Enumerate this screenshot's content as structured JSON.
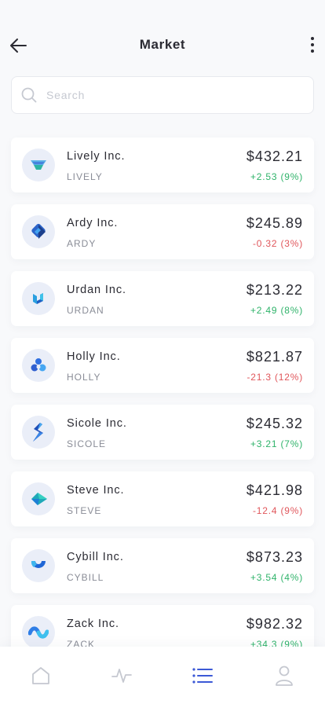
{
  "header": {
    "title": "Market",
    "back_icon": "arrow-left-icon",
    "menu_icon": "more-vertical-icon"
  },
  "search": {
    "placeholder": "Search",
    "value": "",
    "icon": "search-icon"
  },
  "colors": {
    "positive": "#2fb36a",
    "negative": "#e0565b",
    "accent": "#3c59d6",
    "text": "#2b2b33",
    "muted": "#8a8d97"
  },
  "stocks": [
    {
      "name": "Lively Inc.",
      "ticker": "LIVELY",
      "price": "$432.21",
      "change": "+2.53 (9%)",
      "trend": "up",
      "logo": "lively-logo"
    },
    {
      "name": "Ardy Inc.",
      "ticker": "ARDY",
      "price": "$245.89",
      "change": "-0.32 (3%)",
      "trend": "down",
      "logo": "ardy-logo"
    },
    {
      "name": "Urdan Inc.",
      "ticker": "URDAN",
      "price": "$213.22",
      "change": "+2.49 (8%)",
      "trend": "up",
      "logo": "urdan-logo"
    },
    {
      "name": "Holly Inc.",
      "ticker": "HOLLY",
      "price": "$821.87",
      "change": "-21.3 (12%)",
      "trend": "down",
      "logo": "holly-logo"
    },
    {
      "name": "Sicole Inc.",
      "ticker": "SICOLE",
      "price": "$245.32",
      "change": "+3.21 (7%)",
      "trend": "up",
      "logo": "sicole-logo"
    },
    {
      "name": "Steve Inc.",
      "ticker": "STEVE",
      "price": "$421.98",
      "change": "-12.4 (9%)",
      "trend": "down",
      "logo": "steve-logo"
    },
    {
      "name": "Cybill Inc.",
      "ticker": "CYBILL",
      "price": "$873.23",
      "change": "+3.54 (4%)",
      "trend": "up",
      "logo": "cybill-logo"
    },
    {
      "name": "Zack Inc.",
      "ticker": "ZACK",
      "price": "$982.32",
      "change": "+34.3 (9%)",
      "trend": "up",
      "logo": "zack-logo"
    }
  ],
  "tabbar": {
    "tabs": [
      {
        "icon": "home-icon",
        "active": false
      },
      {
        "icon": "activity-icon",
        "active": false
      },
      {
        "icon": "list-icon",
        "active": true
      },
      {
        "icon": "user-icon",
        "active": false
      }
    ]
  }
}
